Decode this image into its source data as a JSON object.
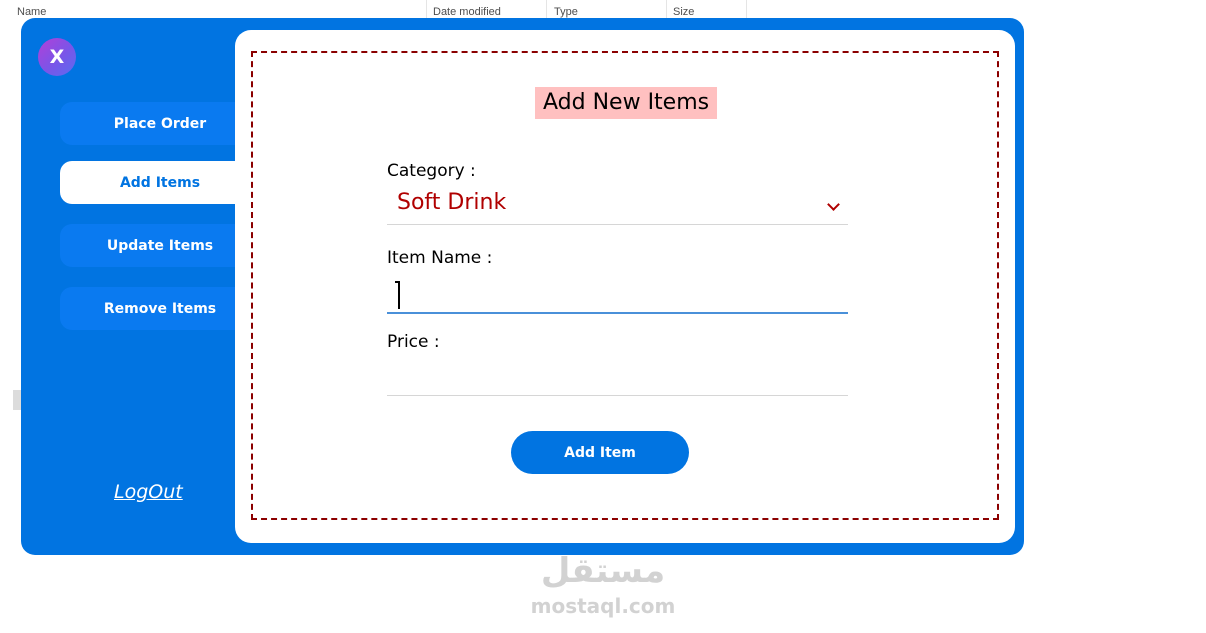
{
  "explorer_header": {
    "name": "Name",
    "date_modified": "Date modified",
    "type": "Type",
    "size": "Size"
  },
  "app": {
    "close_label": "X",
    "nav": [
      {
        "label": "Place Order",
        "active": false
      },
      {
        "label": "Add Items",
        "active": true
      },
      {
        "label": "Update Items",
        "active": false
      },
      {
        "label": "Remove Items",
        "active": false
      }
    ],
    "logout_label": "LogOut"
  },
  "form": {
    "title": "Add New Items",
    "category_label": "Category :",
    "category_value": "Soft Drink",
    "item_name_label": "Item Name :",
    "item_name_value": "",
    "price_label": "Price :",
    "price_value": "",
    "submit_label": "Add Item"
  },
  "watermark": {
    "arabic": "مستقل",
    "latin": "mostaql.com"
  },
  "colors": {
    "primary": "#0174e1",
    "title_bg": "#ffc0c0",
    "accent_text": "#b00000",
    "dashed_border": "#8b0000"
  }
}
